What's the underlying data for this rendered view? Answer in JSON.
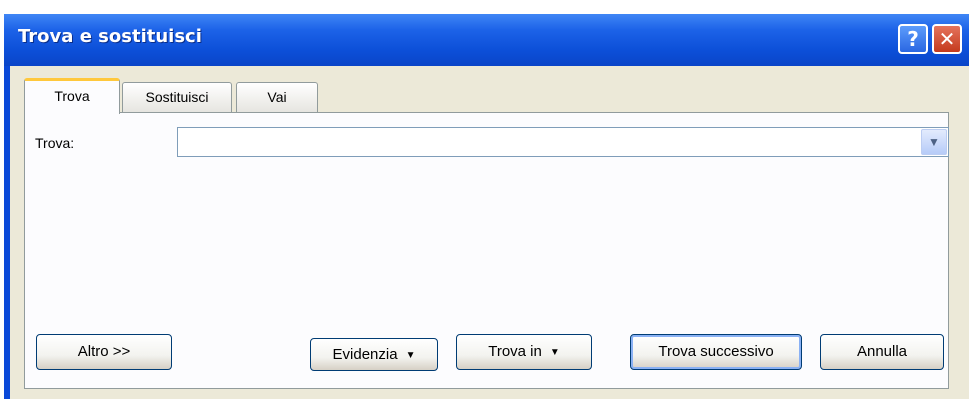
{
  "window": {
    "title": "Trova e sostituisci"
  },
  "title_buttons": {
    "help": "?",
    "close": "✕"
  },
  "tabs": [
    {
      "label": "Trova",
      "active": true
    },
    {
      "label": "Sostituisci",
      "active": false
    },
    {
      "label": "Vai",
      "active": false
    }
  ],
  "find": {
    "label": "Trova:",
    "value": "",
    "placeholder": ""
  },
  "buttons": {
    "altro": "Altro >>",
    "evidenzia": "Evidenzia",
    "trova_in": "Trova in",
    "trova_successivo": "Trova successivo",
    "annulla": "Annulla"
  },
  "colors": {
    "titlebar": "#0c4fd8",
    "dialog_bg": "#ece9d8",
    "active_tab_accent": "#ffc83c"
  }
}
